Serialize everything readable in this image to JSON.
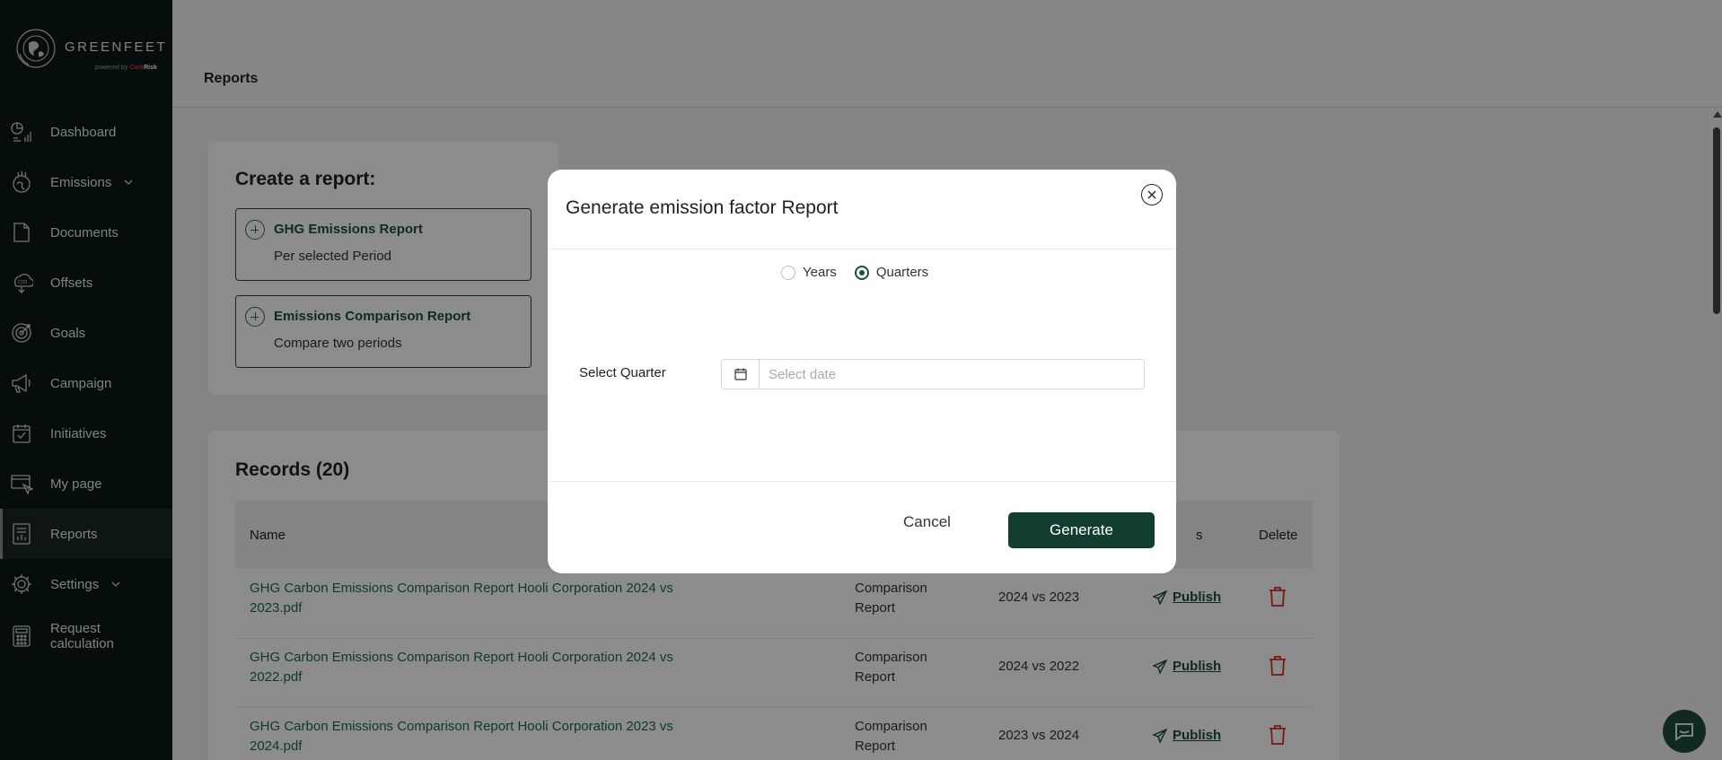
{
  "brand": {
    "name": "GREENFEET",
    "powered_by": "powered by",
    "powered_red": "Carb",
    "powered_white": "Risk"
  },
  "sidebar": {
    "items": [
      {
        "label": "Dashboard",
        "icon": "dashboard-icon"
      },
      {
        "label": "Emissions",
        "icon": "emissions-icon",
        "has_chevron": true
      },
      {
        "label": "Documents",
        "icon": "documents-icon"
      },
      {
        "label": "Offsets",
        "icon": "offsets-icon"
      },
      {
        "label": "Goals",
        "icon": "goals-icon"
      },
      {
        "label": "Campaign",
        "icon": "megaphone-icon"
      },
      {
        "label": "Initiatives",
        "icon": "checkbox-icon"
      },
      {
        "label": "My page",
        "icon": "my-page-icon"
      },
      {
        "label": "Reports",
        "icon": "reports-icon",
        "active": true
      },
      {
        "label": "Settings",
        "icon": "gear-icon",
        "has_chevron": true
      },
      {
        "label": "Request calculation",
        "icon": "calculator-icon"
      }
    ]
  },
  "header": {
    "title": "Reports"
  },
  "create_report": {
    "title": "Create a report:",
    "options": [
      {
        "title": "GHG Emissions Report",
        "subtitle": "Per selected Period"
      },
      {
        "title": "Emissions Comparison Report",
        "subtitle": "Compare two periods"
      }
    ]
  },
  "records": {
    "title": "Records (20)",
    "columns": [
      "Name",
      "s",
      "Delete"
    ],
    "rows": [
      {
        "name": "GHG Carbon Emissions Comparison Report Hooli Corporation 2024 vs 2023.pdf",
        "type": "Comparison Report",
        "period": "2024 vs 2023",
        "action": "Publish"
      },
      {
        "name": "GHG Carbon Emissions Comparison Report Hooli Corporation 2024 vs 2022.pdf",
        "type": "Comparison Report",
        "period": "2024 vs 2022",
        "action": "Publish"
      },
      {
        "name": "GHG Carbon Emissions Comparison Report Hooli Corporation 2023 vs 2024.pdf",
        "type": "Comparison Report",
        "period": "2023 vs 2024",
        "action": "Publish"
      }
    ]
  },
  "modal": {
    "title": "Generate emission factor Report",
    "radio_options": [
      {
        "label": "Years",
        "checked": false
      },
      {
        "label": "Quarters",
        "checked": true
      }
    ],
    "field_label": "Select Quarter",
    "date_placeholder": "Select date",
    "cancel_label": "Cancel",
    "generate_label": "Generate"
  },
  "colors": {
    "sidebar_bg": "#0b1a18",
    "accent": "#123d31",
    "link": "#1d6a4c",
    "delete": "#d32f2f"
  }
}
